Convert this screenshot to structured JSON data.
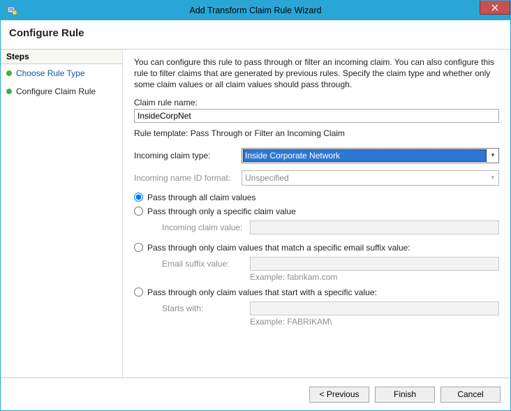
{
  "window": {
    "title": "Add Transform Claim Rule Wizard"
  },
  "header": {
    "title": "Configure Rule"
  },
  "sidebar": {
    "heading": "Steps",
    "items": [
      {
        "label": "Choose Rule Type",
        "state": "done"
      },
      {
        "label": "Configure Claim Rule",
        "state": "current"
      }
    ]
  },
  "main": {
    "intro_text": "You can configure this rule to pass through or filter an incoming claim. You can also configure this rule to filter claims that are generated by previous rules. Specify the claim type and whether only some claim values or all claim values should pass through.",
    "claim_rule_name_label": "Claim rule name:",
    "claim_rule_name_value": "InsideCorpNet",
    "rule_template_line": "Rule template: Pass Through or Filter an Incoming Claim",
    "incoming_claim_type_label": "Incoming claim type:",
    "incoming_claim_type_value": "Inside Corporate Network",
    "incoming_name_id_format_label": "Incoming name ID format:",
    "incoming_name_id_format_value": "Unspecified",
    "radios": {
      "all": "Pass through all claim values",
      "specific": "Pass through only a specific claim value",
      "email_suffix": "Pass through only claim values that match a specific email suffix value:",
      "starts_with": "Pass through only claim values that start with a specific value:",
      "selected": "all"
    },
    "sub_labels": {
      "incoming_claim_value": "Incoming claim value:",
      "email_suffix_value": "Email suffix value:",
      "email_suffix_hint": "Example: fabrikam.com",
      "starts_with": "Starts with:",
      "starts_with_hint": "Example: FABRIKAM\\"
    }
  },
  "footer": {
    "previous": "< Previous",
    "finish": "Finish",
    "cancel": "Cancel"
  }
}
